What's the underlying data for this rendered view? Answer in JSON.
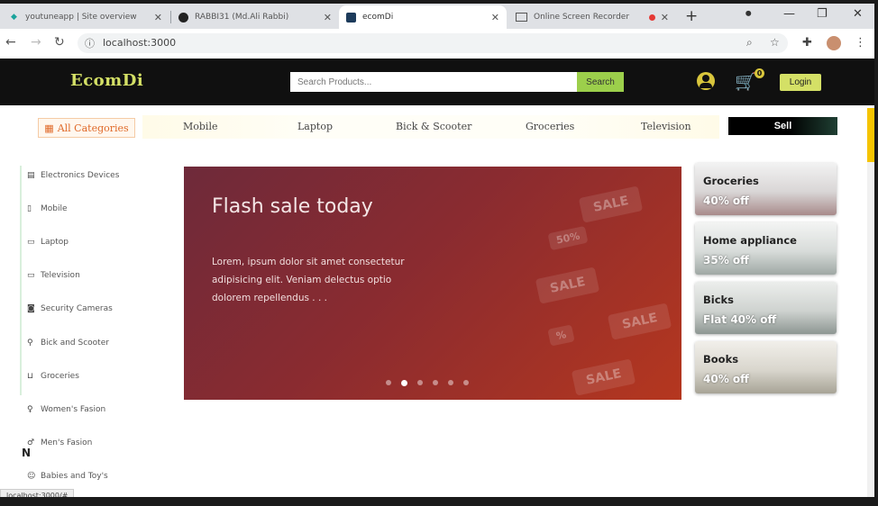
{
  "browser": {
    "tabs": [
      {
        "title": "youtuneapp | Site overview",
        "icon": "diamond-icon",
        "active": false
      },
      {
        "title": "RABBI31 (Md.Ali Rabbi)",
        "icon": "github-icon",
        "active": false
      },
      {
        "title": "ecomDi",
        "icon": "page-icon",
        "active": true
      },
      {
        "title": "Online Screen Recorder",
        "icon": "monitor-icon",
        "active": false
      }
    ],
    "url": "localhost:3000",
    "status_url": "localhost:3000/#"
  },
  "header": {
    "logo": "EcomDi",
    "search_placeholder": "Search Products...",
    "search_button": "Search",
    "cart_count": "0",
    "login_button": "Login"
  },
  "catbar": {
    "all_categories": "All Categories",
    "links": [
      "Mobile",
      "Laptop",
      "Bick & Scooter",
      "Groceries",
      "Television"
    ],
    "sell_button": "Sell"
  },
  "sidebar": {
    "items": [
      {
        "label": "Electronics Devices",
        "icon": "devices-icon"
      },
      {
        "label": "Mobile",
        "icon": "mobile-icon"
      },
      {
        "label": "Laptop",
        "icon": "laptop-icon"
      },
      {
        "label": "Television",
        "icon": "television-icon"
      },
      {
        "label": "Security Cameras",
        "icon": "camera-icon"
      },
      {
        "label": "Bick and Scooter",
        "icon": "bike-icon"
      },
      {
        "label": "Groceries",
        "icon": "basket-icon"
      },
      {
        "label": "Women's Fasion",
        "icon": "dress-icon"
      },
      {
        "label": "Men's Fasion",
        "icon": "shirt-icon"
      },
      {
        "label": "Babies and Toy's",
        "icon": "baby-icon"
      }
    ]
  },
  "banner": {
    "title": "Flash sale today",
    "text": "Lorem, ipsum dolor sit amet consectetur adipisicing elit. Veniam delectus optio dolorem repellendus . . .",
    "tags": [
      "SALE",
      "SALE",
      "SALE",
      "SALE",
      "50%",
      "%"
    ],
    "active_slide": 2,
    "slide_count": 6
  },
  "promos": [
    {
      "title": "Groceries",
      "offer": "40% off"
    },
    {
      "title": "Home appliance",
      "offer": "35% off"
    },
    {
      "title": "Bicks",
      "offer": "Flat 40% off"
    },
    {
      "title": "Books",
      "offer": "40% off"
    }
  ],
  "colors": {
    "accent": "#d4e066",
    "search_button": "#9ccf4b",
    "header_bg": "#101010",
    "banner_start": "#6e2a3a",
    "banner_end": "#b5371f",
    "all_categories": "#e06a2a"
  }
}
